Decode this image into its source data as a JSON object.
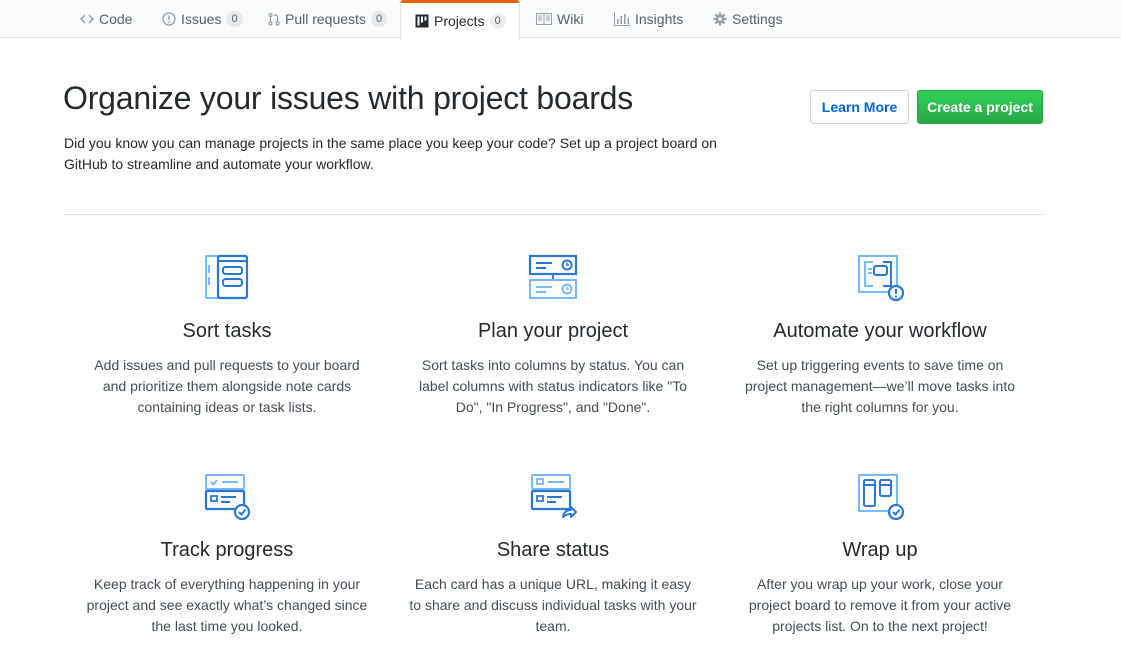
{
  "reponav": {
    "tabs": [
      {
        "label": "Code",
        "icon": "code-icon"
      },
      {
        "label": "Issues",
        "icon": "issue-opened-icon",
        "count": "0"
      },
      {
        "label": "Pull requests",
        "icon": "git-pull-request-icon",
        "count": "0"
      },
      {
        "label": "Projects",
        "icon": "project-icon",
        "count": "0",
        "selected": true
      },
      {
        "label": "Wiki",
        "icon": "book-icon"
      },
      {
        "label": "Insights",
        "icon": "graph-icon"
      },
      {
        "label": "Settings",
        "icon": "gear-icon"
      }
    ]
  },
  "blankslate": {
    "title": "Organize your issues with project boards",
    "description": "Did you know you can manage projects in the same place you keep your code? Set up a project board on GitHub to streamline and automate your workflow.",
    "learn_more_label": "Learn More",
    "create_label": "Create a project"
  },
  "colors": {
    "accent_orange": "#e36209",
    "link_blue": "#0366d6",
    "primary_green": "#28a745",
    "icon_blue": "#2a78d6",
    "icon_light_blue": "#79b8ff"
  },
  "features": [
    {
      "title": "Sort tasks",
      "icon": "sort-tasks-icon",
      "text": "Add issues and pull requests to your board and prioritize them alongside note cards containing ideas or task lists."
    },
    {
      "title": "Plan your project",
      "icon": "plan-project-icon",
      "text": "Sort tasks into columns by status. You can label columns with status indicators like \"To Do\", \"In Progress\", and \"Done\"."
    },
    {
      "title": "Automate your workflow",
      "icon": "automate-workflow-icon",
      "text": "Set up triggering events to save time on project management—we’ll move tasks into the right columns for you."
    },
    {
      "title": "Track progress",
      "icon": "track-progress-icon",
      "text": "Keep track of everything happening in your project and see exactly what’s changed since the last time you looked."
    },
    {
      "title": "Share status",
      "icon": "share-status-icon",
      "text": "Each card has a unique URL, making it easy to share and discuss individual tasks with your team."
    },
    {
      "title": "Wrap up",
      "icon": "wrap-up-icon",
      "text": "After you wrap up your work, close your project board to remove it from your active projects list. On to the next project!"
    }
  ]
}
